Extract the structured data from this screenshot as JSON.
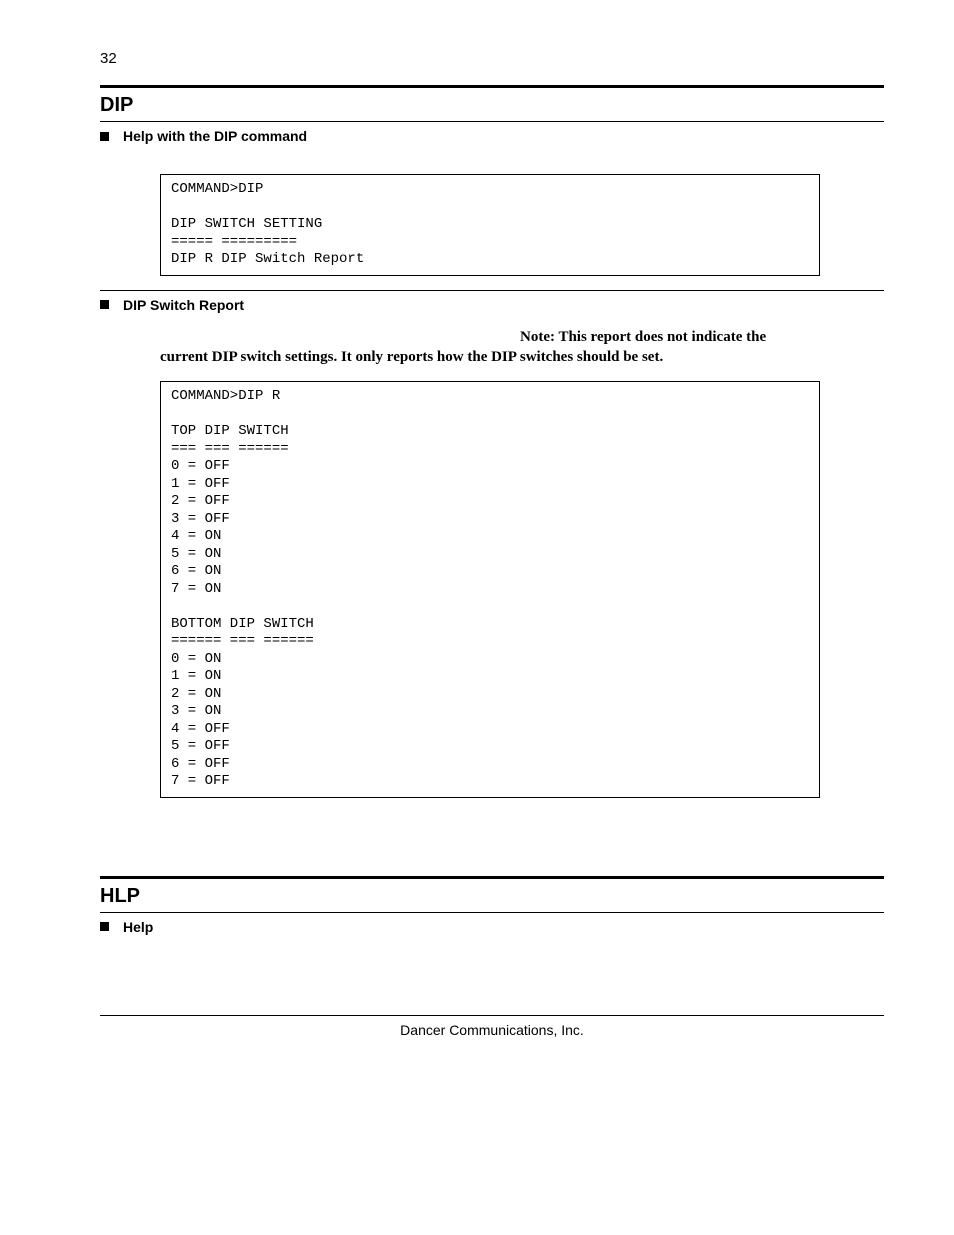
{
  "page_number": "32",
  "section1": {
    "heading": "DIP",
    "sub1": "Help with the DIP command",
    "code1": "COMMAND>DIP\n\nDIP SWITCH SETTING\n===== =========\nDIP R DIP Switch Report",
    "sub2": "DIP Switch Report",
    "note_bold_line1": "Note: This report does not indicate the",
    "note_bold_line2": "current DIP switch settings.  It only reports how the DIP switches should be set.",
    "code2": "COMMAND>DIP R\n\nTOP DIP SWITCH\n=== === ======\n0 = OFF\n1 = OFF\n2 = OFF\n3 = OFF\n4 = ON\n5 = ON\n6 = ON\n7 = ON\n\nBOTTOM DIP SWITCH\n====== === ======\n0 = ON\n1 = ON\n2 = ON\n3 = ON\n4 = OFF\n5 = OFF\n6 = OFF\n7 = OFF\n"
  },
  "section2": {
    "heading": "HLP",
    "sub1": "Help"
  },
  "footer": "Dancer Communications, Inc."
}
